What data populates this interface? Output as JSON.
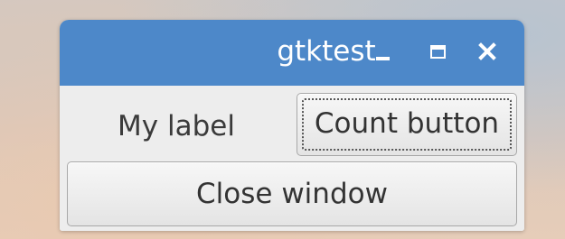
{
  "window": {
    "title": "gtktest",
    "controls": {
      "minimize_icon": "minimize-icon",
      "maximize_icon": "maximize-icon",
      "close_icon": "close-icon"
    },
    "titlebar_color": "#4d88c9"
  },
  "content": {
    "label_text": "My label",
    "count_button_label": "Count button",
    "close_button_label": "Close window"
  }
}
